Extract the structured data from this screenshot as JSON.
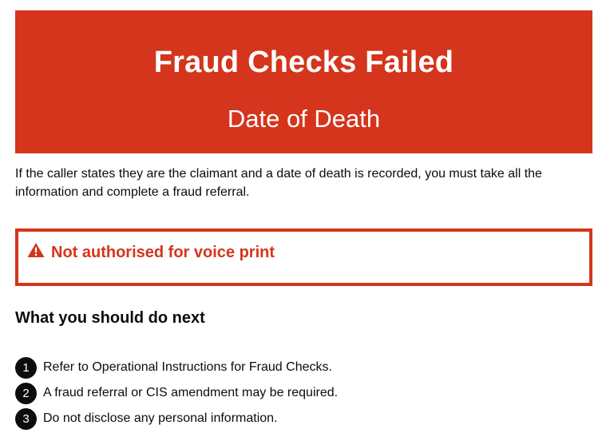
{
  "banner": {
    "title": "Fraud Checks Failed",
    "subtitle": "Date of Death",
    "color": "#d4351c"
  },
  "intro": {
    "text": "If the caller states they are the claimant and a date of death is recorded, you must take all the information and complete a fraud referral."
  },
  "warning": {
    "icon": "warning-triangle-icon",
    "text": "Not authorised for voice print",
    "color": "#d4351c"
  },
  "next_steps": {
    "heading": "What you should do next",
    "items": [
      {
        "number": "1",
        "text": "Refer to Operational Instructions for Fraud Checks."
      },
      {
        "number": "2",
        "text": "A fraud referral or CIS amendment may be required."
      },
      {
        "number": "3",
        "text": "Do not disclose any personal information."
      }
    ]
  }
}
